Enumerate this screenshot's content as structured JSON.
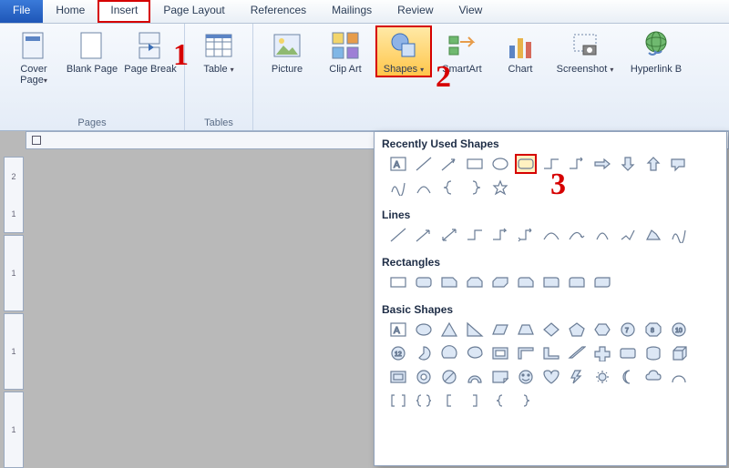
{
  "tabs": {
    "file": "File",
    "home": "Home",
    "insert": "Insert",
    "page_layout": "Page Layout",
    "references": "References",
    "mailings": "Mailings",
    "review": "Review",
    "view": "View",
    "active": "Insert"
  },
  "ribbon": {
    "pages": {
      "label": "Pages",
      "cover_page": "Cover Page",
      "blank_page": "Blank Page",
      "page_break": "Page Break"
    },
    "tables": {
      "label": "Tables",
      "table": "Table"
    },
    "illustrations": {
      "picture": "Picture",
      "clip_art": "Clip Art",
      "shapes": "Shapes",
      "smartart": "SmartArt",
      "chart": "Chart",
      "screenshot": "Screenshot"
    },
    "links": {
      "hyperlink": "Hyperlink B"
    }
  },
  "shapes_panel": {
    "recently_used": "Recently Used Shapes",
    "lines": "Lines",
    "rectangles": "Rectangles",
    "basic_shapes": "Basic Shapes"
  },
  "callouts": {
    "one": "1",
    "two": "2",
    "three": "3"
  },
  "ruler": {
    "marks": [
      "2",
      "1",
      "1",
      "1",
      "1"
    ]
  },
  "colors": {
    "accent": "#1e56b7",
    "highlight": "#d60000",
    "selected_bg": "#ffc64b"
  }
}
